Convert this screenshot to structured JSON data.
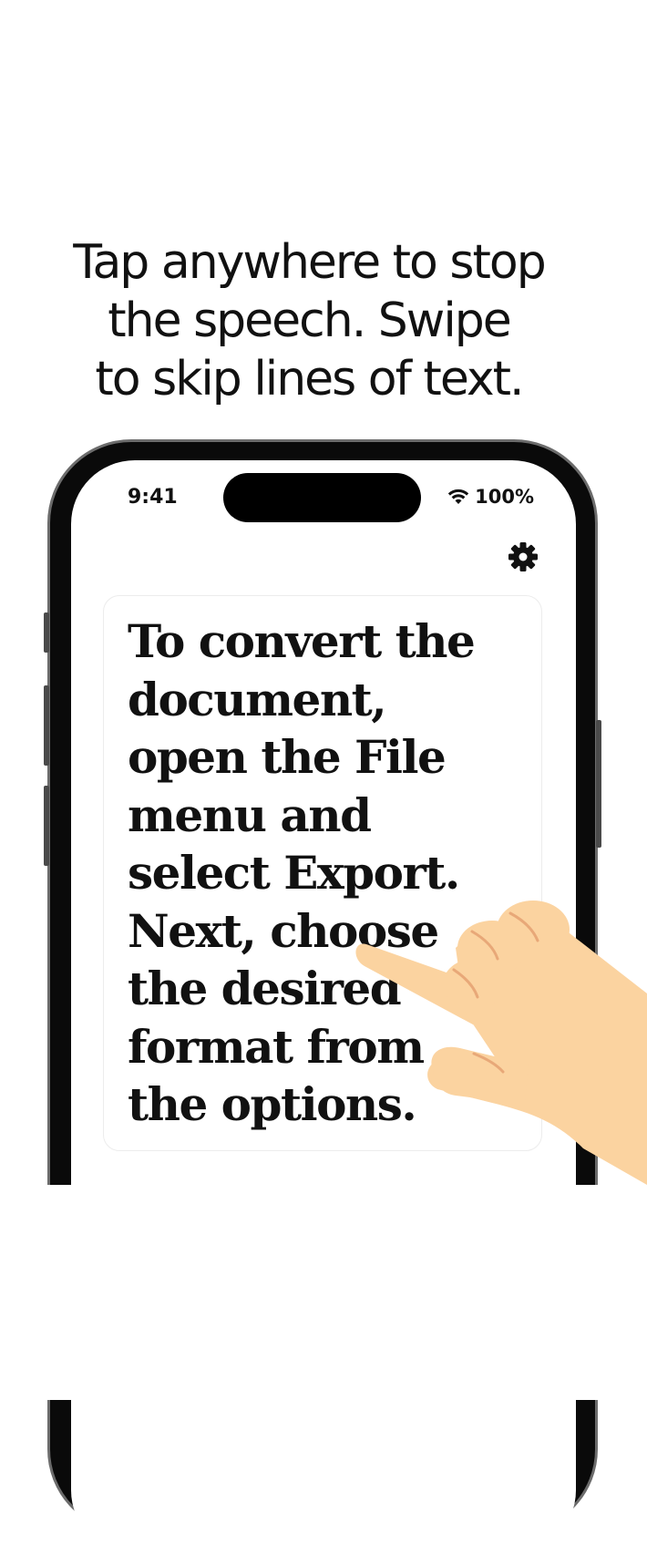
{
  "headline": {
    "lines": [
      "Tap anywhere to stop",
      "the speech. Swipe",
      "to skip lines of text."
    ]
  },
  "status_bar": {
    "time": "9:41",
    "battery": "100%",
    "icons": [
      "wifi-icon"
    ]
  },
  "toolbar": {
    "settings_icon": "gear-icon"
  },
  "reader": {
    "lines": [
      "To convert the",
      "document,",
      "open the File",
      "menu and",
      "select Export.",
      "Next, choose",
      "the desired",
      "format from",
      "the options."
    ]
  },
  "overlay": {
    "hand_icon": "tapping-hand-icon"
  },
  "colors": {
    "text": "#111111",
    "phone_frame": "#0a0a0a",
    "hand": "#fbd3a0"
  }
}
